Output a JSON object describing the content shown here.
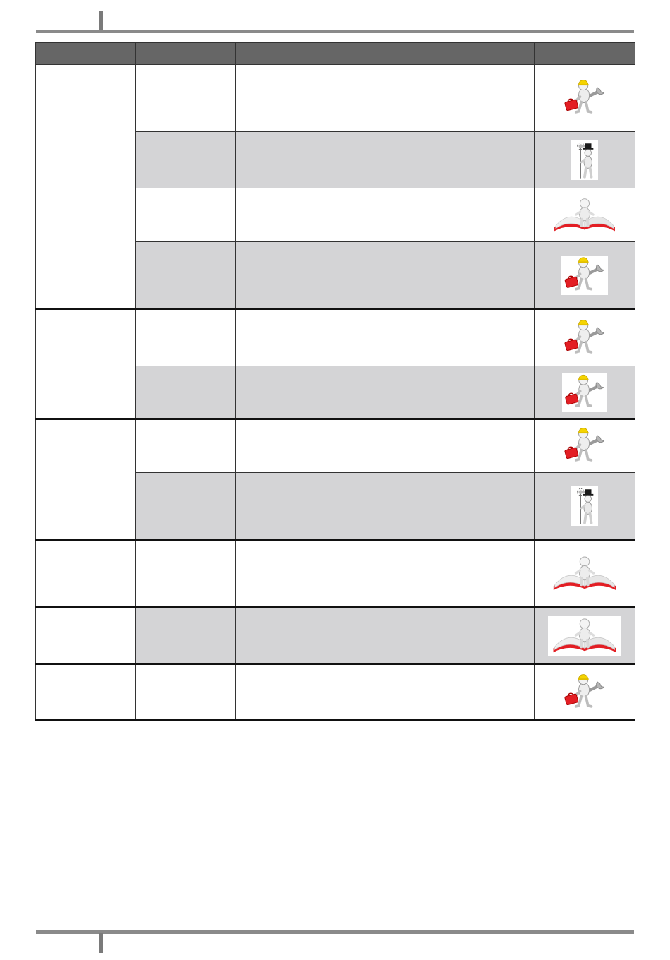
{
  "table": {
    "headers": [
      "",
      "",
      "",
      ""
    ],
    "rows": [
      {
        "col1": "",
        "col2": "",
        "col3": "",
        "icon": "technician-toolbox-icon"
      },
      {
        "col2": "",
        "col3": "",
        "icon": "chimney-sweep-icon"
      },
      {
        "col2": "",
        "col3": "",
        "icon": "user-manual-book-icon"
      },
      {
        "col2": "",
        "col3": "",
        "icon": "technician-toolbox-icon"
      },
      {
        "col1": "",
        "col2": "",
        "col3": "",
        "icon": "technician-toolbox-icon"
      },
      {
        "col2": "",
        "col3": "",
        "icon": "technician-toolbox-icon"
      },
      {
        "col1": "",
        "col2": "",
        "col3": "",
        "icon": "technician-toolbox-icon"
      },
      {
        "col2": "",
        "col3": "",
        "icon": "chimney-sweep-icon"
      },
      {
        "col1": "",
        "col2": "",
        "col3": "",
        "icon": "user-manual-book-icon"
      },
      {
        "col1": "",
        "col2": "",
        "col3": "",
        "icon": "user-manual-book-icon"
      },
      {
        "col1": "",
        "col2": "",
        "col3": "",
        "icon": "technician-toolbox-icon"
      }
    ]
  },
  "colors": {
    "header_bg": "#666666",
    "shade_bg": "#d4d4d6",
    "rule": "#8a8a8a"
  }
}
